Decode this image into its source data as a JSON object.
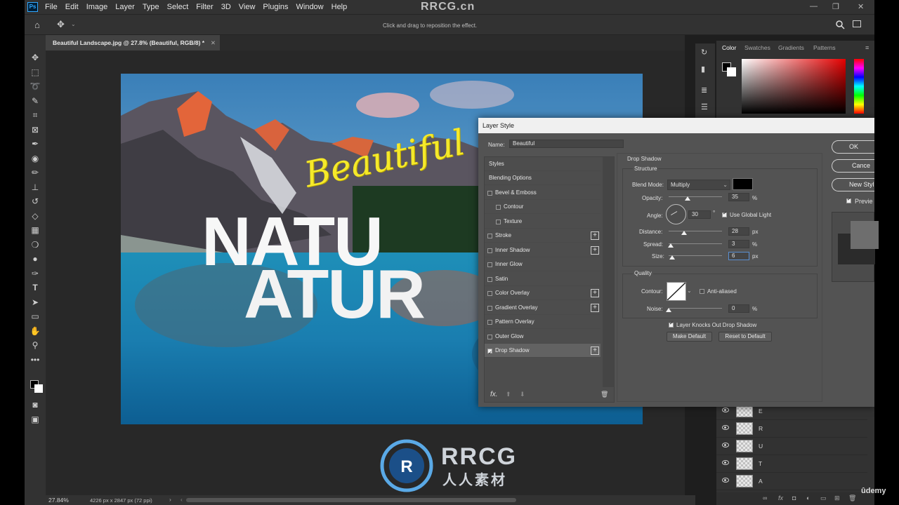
{
  "app": {
    "menu": [
      "File",
      "Edit",
      "Image",
      "Layer",
      "Type",
      "Select",
      "Filter",
      "3D",
      "View",
      "Plugins",
      "Window",
      "Help"
    ],
    "hint": "Click and drag to reposition the effect.",
    "doc_tab": "Beautiful Landscape.jpg @ 27.8% (Beautiful, RGB/8) *",
    "zoom": "27.84%",
    "doc_info": "4226 px x 2847 px (72 ppi)"
  },
  "canvas_text": {
    "script": "Beautiful",
    "big_row1": "NATU",
    "big_row2": "ATUR"
  },
  "color_panel": {
    "tabs": [
      "Color",
      "Swatches",
      "Gradients",
      "Patterns"
    ]
  },
  "layers": [
    "E",
    "R",
    "U",
    "T",
    "A"
  ],
  "dialog": {
    "title": "Layer Style",
    "name_label": "Name:",
    "name_value": "Beautiful",
    "styles_header": "Styles",
    "style_items": [
      {
        "label": "Blending Options",
        "checkbox": false,
        "indent": false,
        "plus": false,
        "checked": false
      },
      {
        "label": "Bevel & Emboss",
        "checkbox": true,
        "indent": false,
        "plus": false,
        "checked": false
      },
      {
        "label": "Contour",
        "checkbox": true,
        "indent": true,
        "plus": false,
        "checked": false
      },
      {
        "label": "Texture",
        "checkbox": true,
        "indent": true,
        "plus": false,
        "checked": false
      },
      {
        "label": "Stroke",
        "checkbox": true,
        "indent": false,
        "plus": true,
        "checked": false
      },
      {
        "label": "Inner Shadow",
        "checkbox": true,
        "indent": false,
        "plus": true,
        "checked": false
      },
      {
        "label": "Inner Glow",
        "checkbox": true,
        "indent": false,
        "plus": false,
        "checked": false
      },
      {
        "label": "Satin",
        "checkbox": true,
        "indent": false,
        "plus": false,
        "checked": false
      },
      {
        "label": "Color Overlay",
        "checkbox": true,
        "indent": false,
        "plus": true,
        "checked": false
      },
      {
        "label": "Gradient Overlay",
        "checkbox": true,
        "indent": false,
        "plus": true,
        "checked": false
      },
      {
        "label": "Pattern Overlay",
        "checkbox": true,
        "indent": false,
        "plus": false,
        "checked": false
      },
      {
        "label": "Outer Glow",
        "checkbox": true,
        "indent": false,
        "plus": false,
        "checked": false
      },
      {
        "label": "Drop Shadow",
        "checkbox": true,
        "indent": false,
        "plus": true,
        "checked": true
      }
    ],
    "section": "Drop Shadow",
    "structure": "Structure",
    "blend_mode_label": "Blend Mode:",
    "blend_mode_value": "Multiply",
    "opacity_label": "Opacity:",
    "opacity_value": "35",
    "angle_label": "Angle:",
    "angle_value": "30",
    "degree": "°",
    "use_global_light": "Use Global Light",
    "distance_label": "Distance:",
    "distance_value": "28",
    "spread_label": "Spread:",
    "spread_value": "3",
    "size_label": "Size:",
    "size_value": "6",
    "unit_percent": "%",
    "unit_px": "px",
    "quality": "Quality",
    "contour_label": "Contour:",
    "anti_aliased": "Anti-aliased",
    "noise_label": "Noise:",
    "noise_value": "0",
    "knockout": "Layer Knocks Out Drop Shadow",
    "make_default": "Make Default",
    "reset_default": "Reset to Default",
    "ok": "OK",
    "cancel": "Cance",
    "new_style": "New Styl",
    "preview": "Previe",
    "fx": "fx."
  },
  "watermark": {
    "top": "RRCG.cn",
    "logo_main": "RRCG",
    "logo_sub": "人人素材",
    "udemy": "ûdemy"
  },
  "colors": {
    "accent": "#31a8ff",
    "panel": "#323232",
    "dialog": "#535353",
    "shadow_color": "#000000"
  }
}
